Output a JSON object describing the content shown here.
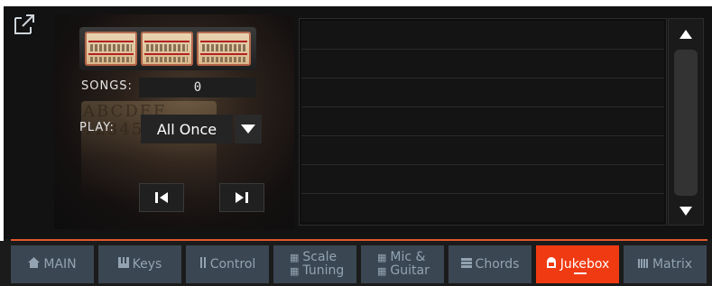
{
  "jukebox": {
    "songs_label": "SONGS:",
    "songs_value": "0",
    "play_label": "PLAY:",
    "play_mode": "All Once",
    "decorative_letters": "ABCDEF\n123456789"
  },
  "tabs": [
    {
      "label": "MAIN",
      "icon": "home-icon"
    },
    {
      "label": "Keys",
      "icon": "keys-icon"
    },
    {
      "label": "Control",
      "icon": "control-icon"
    },
    {
      "label_line1": "Scale",
      "label_line2": "Tuning",
      "icon": "scale-icon"
    },
    {
      "label_line1": "Mic &",
      "label_line2": "Guitar",
      "icon": "mic-guitar-icon"
    },
    {
      "label": "Chords",
      "icon": "chords-icon"
    },
    {
      "label": "Jukebox",
      "icon": "jukebox-icon"
    },
    {
      "label": "Matrix",
      "icon": "matrix-icon"
    }
  ],
  "active_tab": "Jukebox",
  "colors": {
    "accent": "#f03a12",
    "tab_bg": "#3a4652",
    "tab_text": "#93a3b1",
    "divider": "#e0582c"
  }
}
